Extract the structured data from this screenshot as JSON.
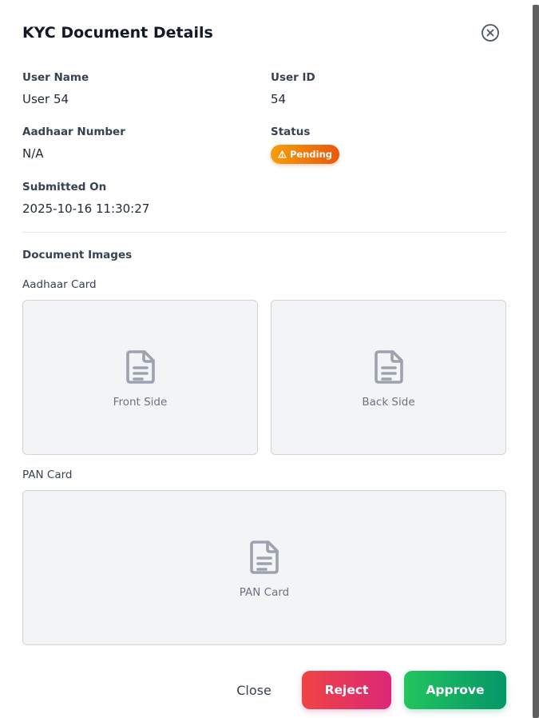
{
  "modal": {
    "title": "KYC Document Details"
  },
  "fields": {
    "user_name": {
      "label": "User Name",
      "value": "User 54"
    },
    "user_id": {
      "label": "User ID",
      "value": "54"
    },
    "aadhaar_number": {
      "label": "Aadhaar Number",
      "value": "N/A"
    },
    "status": {
      "label": "Status",
      "value": "Pending",
      "icon": "warning-triangle-icon",
      "color_from": "#f59e0b",
      "color_to": "#ea580c"
    },
    "submitted_on": {
      "label": "Submitted On",
      "value": "2025-10-16 11:30:27"
    }
  },
  "documents": {
    "section_title": "Document Images",
    "aadhaar": {
      "label": "Aadhaar Card",
      "front": {
        "caption": "Front Side",
        "icon": "document-icon"
      },
      "back": {
        "caption": "Back Side",
        "icon": "document-icon"
      }
    },
    "pan": {
      "label": "PAN Card",
      "card": {
        "caption": "PAN Card",
        "icon": "document-icon"
      }
    }
  },
  "actions": {
    "close_label": "Close",
    "reject_label": "Reject",
    "approve_label": "Approve",
    "reject_color": "#ef4444",
    "approve_color": "#22c55e"
  }
}
